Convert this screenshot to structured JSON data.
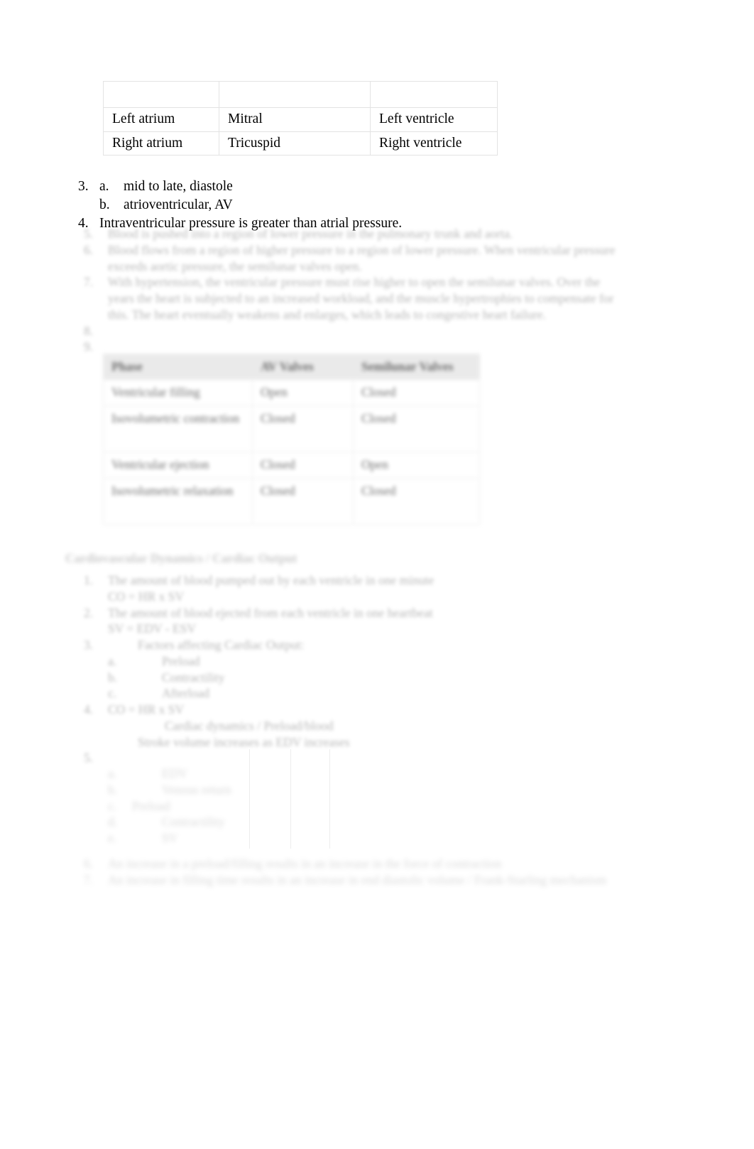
{
  "document": {
    "type": "study-guide-answer-key",
    "page_background": "#ffffff",
    "text_color": "#000000"
  },
  "valve_table": {
    "name": "heart-chambers-and-valves-table",
    "has_empty_header_row": true,
    "columns": [
      "",
      "",
      ""
    ],
    "rows": [
      [
        "Left atrium",
        "Mitral",
        "Left ventricle"
      ],
      [
        "Right atrium",
        "Tricuspid",
        "Right ventricle"
      ]
    ]
  },
  "answers": {
    "items": [
      {
        "number": "3.",
        "subitems": [
          {
            "letter": "a.",
            "text": "mid to late, diastole"
          },
          {
            "letter": "b.",
            "text": "atrioventricular, AV"
          }
        ]
      },
      {
        "number": "4.",
        "text": "Intraventricular pressure is greater than atrial pressure."
      }
    ]
  },
  "faded_answers": {
    "legible": false,
    "note_visible_in_pixels": "text is blurred in the source image",
    "items": [
      {
        "number": "5.",
        "text": "Blood is pushed into a region of lower pressure in the pulmonary trunk and aorta."
      },
      {
        "number": "6.",
        "text": "Blood flows from a region of higher pressure to a region of lower pressure. When ventricular pressure"
      },
      {
        "number": "",
        "text": "exceeds aortic pressure, the semilunar valves open."
      },
      {
        "number": "7.",
        "text": "With hypertension, the ventricular pressure must rise higher to open the semilunar valves. Over the"
      },
      {
        "number": "",
        "text": "years the heart is subjected to an increased workload, and the muscle hypertrophies to compensate for"
      },
      {
        "number": "",
        "text": "this. The heart eventually weakens and enlarges, which leads to congestive heart failure."
      },
      {
        "number": "8.",
        "text": ""
      },
      {
        "number": "9.",
        "text": ""
      }
    ]
  },
  "phase_table": {
    "name": "cardiac-cycle-phase-table",
    "legible": false,
    "columns": [
      "Phase",
      "AV Valves",
      "Semilunar Valves"
    ],
    "rows": [
      [
        "Ventricular filling",
        "Open",
        "Closed"
      ],
      [
        "Isovolumetric contraction",
        "Closed",
        "Closed"
      ],
      [
        "Ventricular ejection",
        "Closed",
        "Open"
      ],
      [
        "Isovolumetric relaxation",
        "Closed",
        "Closed"
      ]
    ]
  },
  "section": {
    "heading": "Cardiovascular Dynamics / Cardiac Output",
    "legible": false
  },
  "co_items": {
    "legible": false,
    "items": [
      {
        "number": "1.",
        "text": "The amount of blood pumped out by each ventricle in one minute"
      },
      {
        "number": "",
        "text": "CO  =  HR  x  SV"
      },
      {
        "number": "2.",
        "text": "The amount of blood ejected from each ventricle in one heartbeat"
      },
      {
        "number": "",
        "text": "SV  =  EDV  -  ESV"
      },
      {
        "number": "3.",
        "text": "Factors affecting Cardiac Output:"
      },
      {
        "letter": "a.",
        "text": "Preload"
      },
      {
        "letter": "b.",
        "text": "Contractility"
      },
      {
        "letter": "c.",
        "text": "Afterload"
      },
      {
        "number": "4.",
        "text": "CO  =  HR  x  SV"
      },
      {
        "letter": "a.",
        "text": "Cardiac dynamics / Preload/blood"
      },
      {
        "letter": "b.",
        "text": "Stroke volume increases as EDV increases"
      },
      {
        "number": "5.",
        "text": ""
      },
      {
        "letter": "a.",
        "text": "EDV"
      },
      {
        "letter": "b.",
        "text": "Venous return"
      },
      {
        "letter": "c.",
        "text": "Preload"
      },
      {
        "letter": "d.",
        "text": "Contractility"
      },
      {
        "letter": "e.",
        "text": "SV"
      },
      {
        "number": "6.",
        "text": "An increase in a preload/filling results in an increase in the force of contraction"
      },
      {
        "number": "7.",
        "text": "An increase in filling time results in an increase in end diastolic volume / Frank-Starling mechanism"
      }
    ]
  }
}
